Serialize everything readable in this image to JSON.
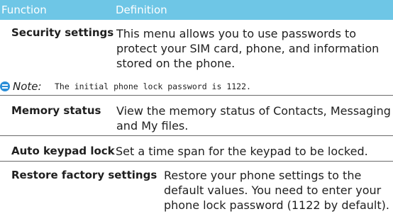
{
  "table": {
    "header": {
      "col1": "Function",
      "col2": "Definition"
    },
    "rows": [
      {
        "term": "Security settings",
        "definition": "This menu allows you to use passwords to protect your SIM card,  phone,  and information stored on the phone."
      },
      {
        "term": "Memory status",
        "definition": "View the memory status of Contacts, Messaging and My files."
      },
      {
        "term": "Auto keypad lock",
        "definition": "Set a time span for the keypad to be locked."
      },
      {
        "term": "Restore factory settings",
        "definition": "Restore your phone settings to the default values. You need to enter your phone lock password (1122 by default)."
      }
    ]
  },
  "note": {
    "label": "Note:",
    "text": "The initial phone lock password is 1122.",
    "icon": "note-icon"
  },
  "colors": {
    "header_bg": "#6ec6e6",
    "header_text": "#ffffff",
    "note_icon": "#2c8fd8"
  }
}
